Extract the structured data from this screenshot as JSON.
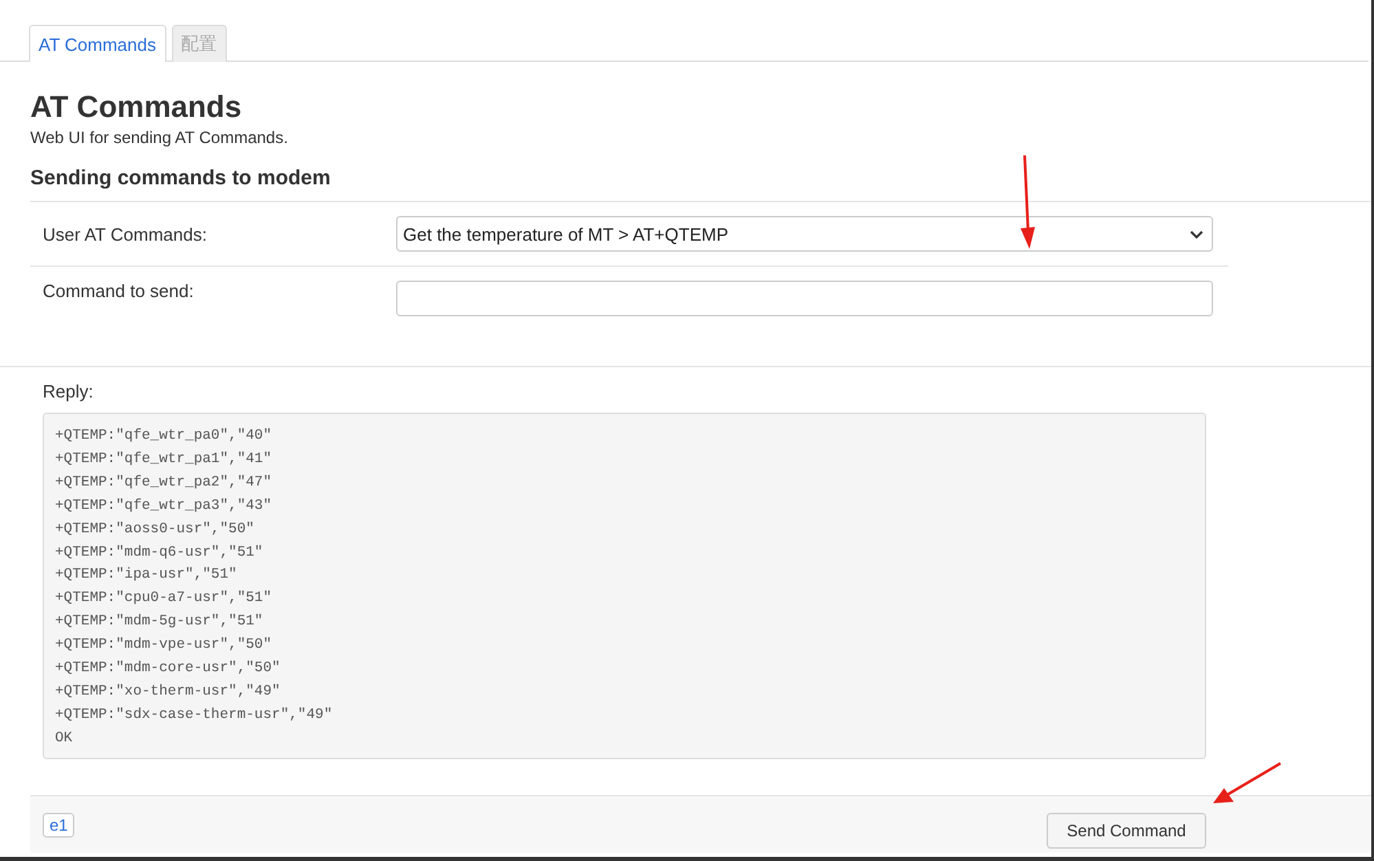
{
  "tabs": [
    {
      "label": "AT Commands",
      "selected": true
    },
    {
      "label": "配置",
      "selected": false
    }
  ],
  "page": {
    "title": "AT Commands",
    "subtitle": "Web UI for sending AT Commands."
  },
  "section": {
    "title": "Sending commands to modem"
  },
  "form": {
    "rows": [
      {
        "kind": "select",
        "label": "User AT Commands:",
        "value": "Get the temperature of MT > AT+QTEMP"
      },
      {
        "kind": "text",
        "label": "Command to send:",
        "value": ""
      }
    ]
  },
  "reply": {
    "label": "Reply:",
    "lines": [
      "+QTEMP:\"qfe_wtr_pa0\",\"40\"",
      "+QTEMP:\"qfe_wtr_pa1\",\"41\"",
      "+QTEMP:\"qfe_wtr_pa2\",\"47\"",
      "+QTEMP:\"qfe_wtr_pa3\",\"43\"",
      "+QTEMP:\"aoss0-usr\",\"50\"",
      "+QTEMP:\"mdm-q6-usr\",\"51\"",
      "+QTEMP:\"ipa-usr\",\"51\"",
      "+QTEMP:\"cpu0-a7-usr\",\"51\"",
      "+QTEMP:\"mdm-5g-usr\",\"51\"",
      "+QTEMP:\"mdm-vpe-usr\",\"50\"",
      "+QTEMP:\"mdm-core-usr\",\"50\"",
      "+QTEMP:\"xo-therm-usr\",\"49\"",
      "+QTEMP:\"sdx-case-therm-usr\",\"49\"",
      "OK"
    ]
  },
  "footer": {
    "badge": "e1",
    "button": "Send Command"
  }
}
